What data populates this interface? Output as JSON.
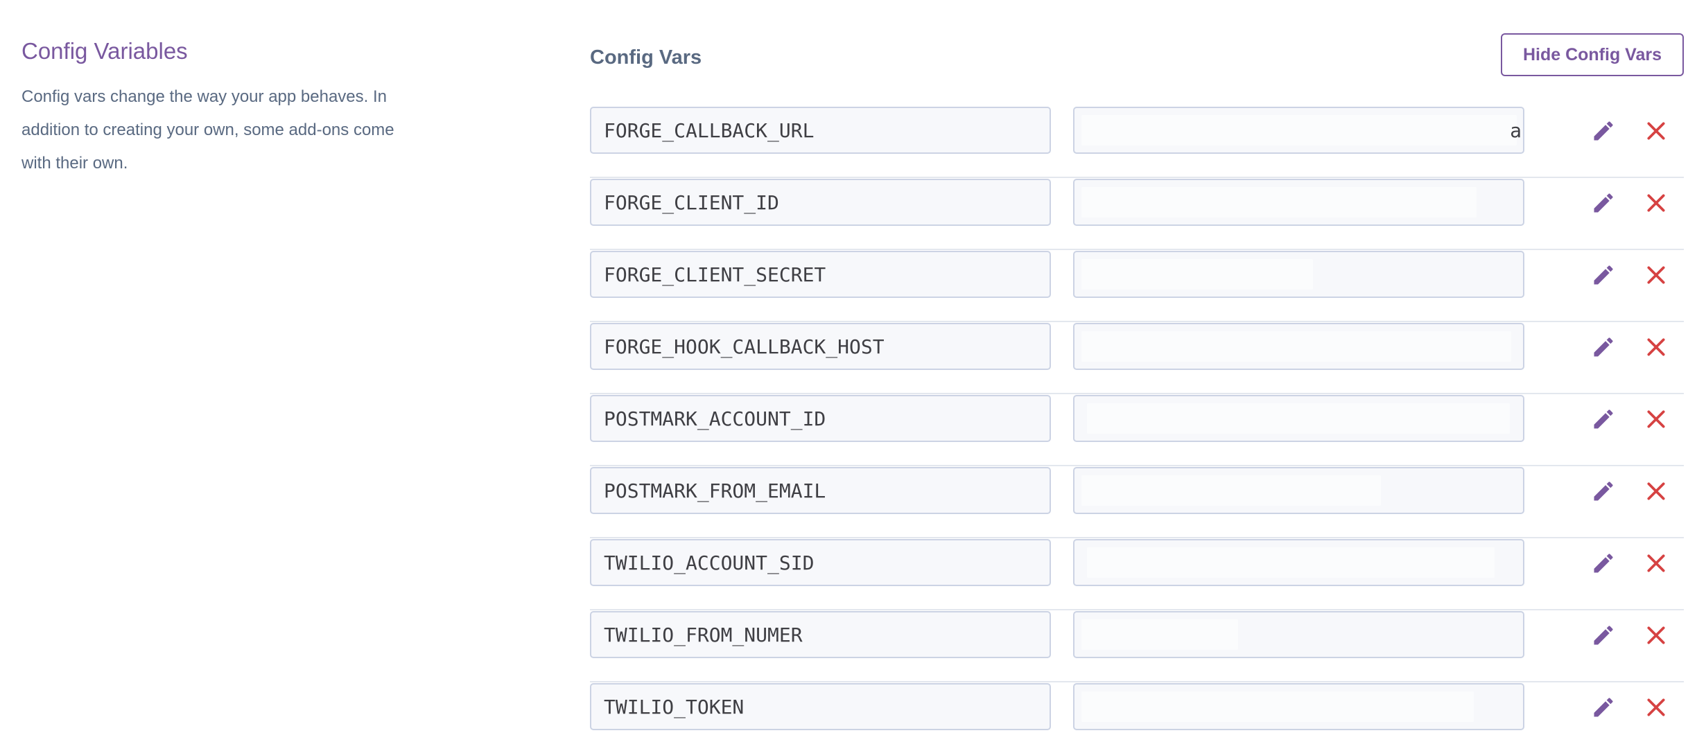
{
  "section": {
    "title": "Config Variables",
    "description": "Config vars change the way your app behaves. In addition to creating your own, some add-ons come with their own."
  },
  "config_vars": {
    "title": "Config Vars",
    "hide_button_label": "Hide Config Vars",
    "rows": [
      {
        "key": "FORGE_CALLBACK_URL",
        "value_tail": "a"
      },
      {
        "key": "FORGE_CLIENT_ID"
      },
      {
        "key": "FORGE_CLIENT_SECRET"
      },
      {
        "key": "FORGE_HOOK_CALLBACK_HOST"
      },
      {
        "key": "POSTMARK_ACCOUNT_ID"
      },
      {
        "key": "POSTMARK_FROM_EMAIL"
      },
      {
        "key": "TWILIO_ACCOUNT_SID"
      },
      {
        "key": "TWILIO_FROM_NUMER"
      },
      {
        "key": "TWILIO_TOKEN"
      }
    ]
  },
  "icons": {
    "edit": "pencil-icon",
    "delete": "close-icon"
  },
  "colors": {
    "accent": "#79589f",
    "text": "#596981",
    "danger": "#d64242",
    "input_border": "#ccd3e4",
    "input_bg": "#f7f8fb"
  }
}
